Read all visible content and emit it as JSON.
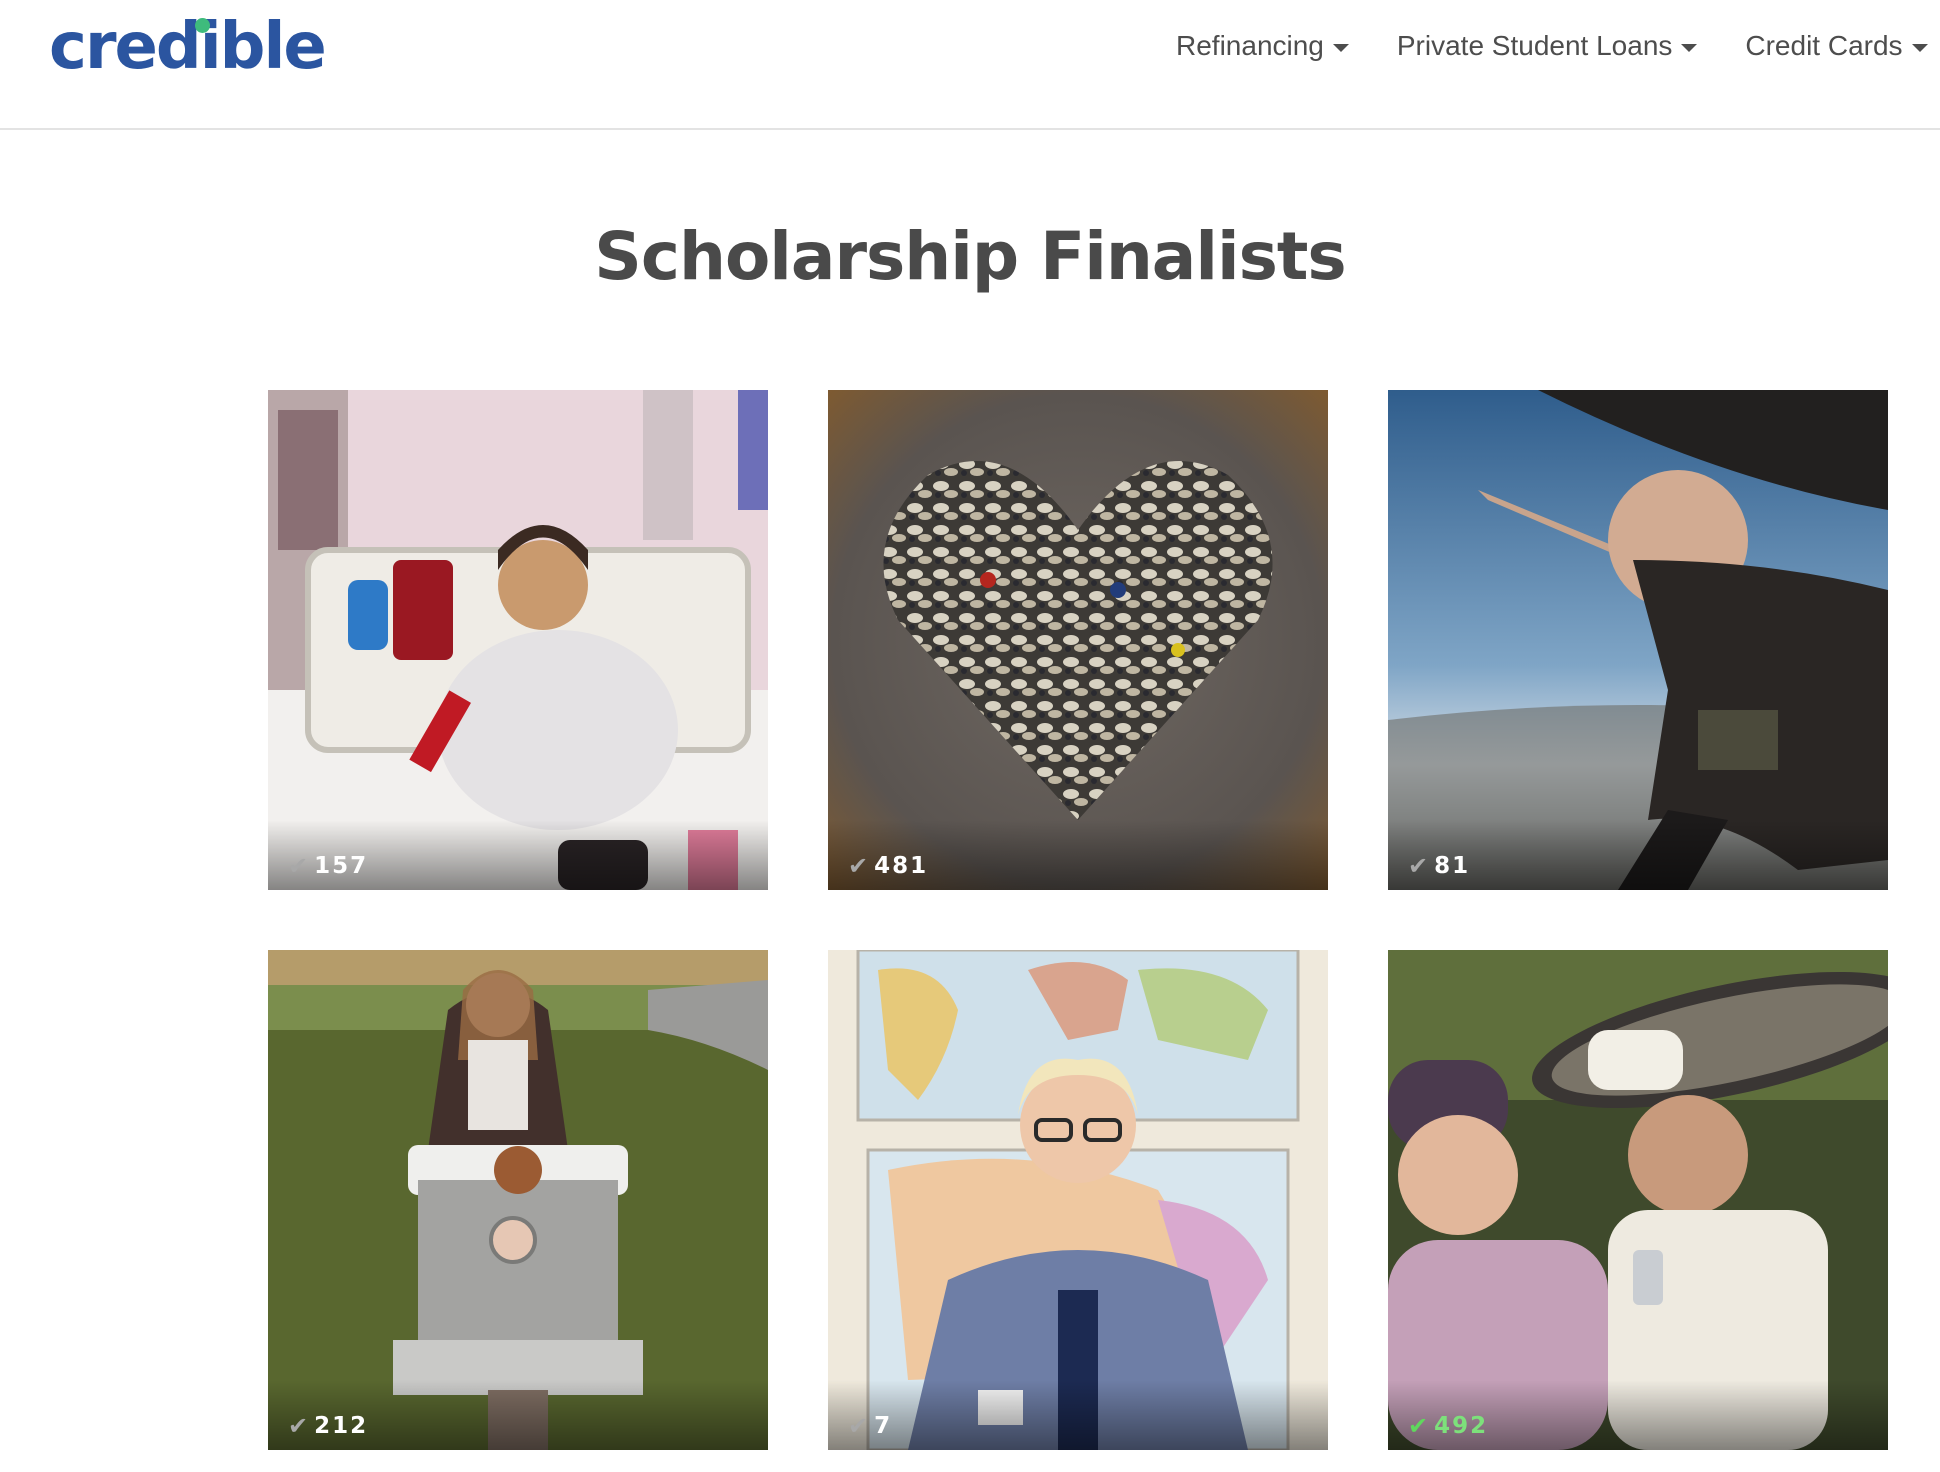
{
  "brand": {
    "logo_text": "credible",
    "logo_color": "#2b55a0",
    "dot_color": "#3ebb7c"
  },
  "nav": {
    "items": [
      {
        "label": "Refinancing"
      },
      {
        "label": "Private Student Loans"
      },
      {
        "label": "Credit Cards"
      }
    ]
  },
  "page": {
    "title": "Scholarship Finalists"
  },
  "finalists": [
    {
      "votes": "157",
      "photo": "hospital-bed-photo"
    },
    {
      "votes": "481",
      "photo": "shoe-heart-photo"
    },
    {
      "votes": "81",
      "photo": "skydiving-photo"
    },
    {
      "votes": "212",
      "photo": "gravestone-photo"
    },
    {
      "votes": "7",
      "photo": "world-map-portrait-photo"
    },
    {
      "votes": "492",
      "photo": "two-women-photo",
      "voted": true
    }
  ]
}
